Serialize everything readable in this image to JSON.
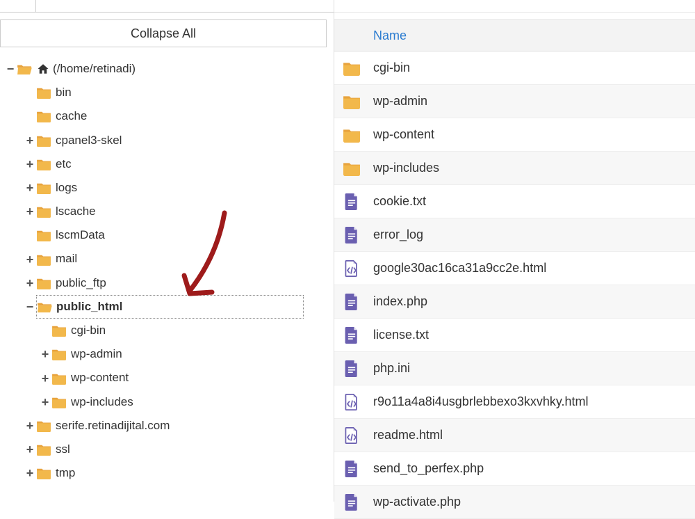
{
  "left": {
    "collapse_label": "Collapse All",
    "root_label": "(/home/retinadi)",
    "tree": [
      {
        "label": "bin",
        "toggle": "",
        "indent": 1,
        "open": false
      },
      {
        "label": "cache",
        "toggle": "",
        "indent": 1,
        "open": false
      },
      {
        "label": "cpanel3-skel",
        "toggle": "+",
        "indent": 1,
        "open": false
      },
      {
        "label": "etc",
        "toggle": "+",
        "indent": 1,
        "open": false
      },
      {
        "label": "logs",
        "toggle": "+",
        "indent": 1,
        "open": false
      },
      {
        "label": "lscache",
        "toggle": "+",
        "indent": 1,
        "open": false
      },
      {
        "label": "lscmData",
        "toggle": "",
        "indent": 1,
        "open": false
      },
      {
        "label": "mail",
        "toggle": "+",
        "indent": 1,
        "open": false
      },
      {
        "label": "public_ftp",
        "toggle": "+",
        "indent": 1,
        "open": false
      },
      {
        "label": "public_html",
        "toggle": "−",
        "indent": 1,
        "open": true,
        "selected": true,
        "bold": true
      },
      {
        "label": "cgi-bin",
        "toggle": "",
        "indent": 2,
        "open": false
      },
      {
        "label": "wp-admin",
        "toggle": "+",
        "indent": 2,
        "open": false
      },
      {
        "label": "wp-content",
        "toggle": "+",
        "indent": 2,
        "open": false
      },
      {
        "label": "wp-includes",
        "toggle": "+",
        "indent": 2,
        "open": false
      },
      {
        "label": "serife.retinadijital.com",
        "toggle": "+",
        "indent": 1,
        "open": false
      },
      {
        "label": "ssl",
        "toggle": "+",
        "indent": 1,
        "open": false
      },
      {
        "label": "tmp",
        "toggle": "+",
        "indent": 1,
        "open": false
      }
    ]
  },
  "right": {
    "header": "Name",
    "files": [
      {
        "name": "cgi-bin",
        "type": "folder"
      },
      {
        "name": "wp-admin",
        "type": "folder"
      },
      {
        "name": "wp-content",
        "type": "folder"
      },
      {
        "name": "wp-includes",
        "type": "folder"
      },
      {
        "name": "cookie.txt",
        "type": "doc"
      },
      {
        "name": "error_log",
        "type": "doc"
      },
      {
        "name": "google30ac16ca31a9cc2e.html",
        "type": "html"
      },
      {
        "name": "index.php",
        "type": "doc"
      },
      {
        "name": "license.txt",
        "type": "doc"
      },
      {
        "name": "php.ini",
        "type": "doc"
      },
      {
        "name": "r9o11a4a8i4usgbrlebbexo3kxvhky.html",
        "type": "html"
      },
      {
        "name": "readme.html",
        "type": "html"
      },
      {
        "name": "send_to_perfex.php",
        "type": "doc"
      },
      {
        "name": "wp-activate.php",
        "type": "doc"
      }
    ]
  }
}
